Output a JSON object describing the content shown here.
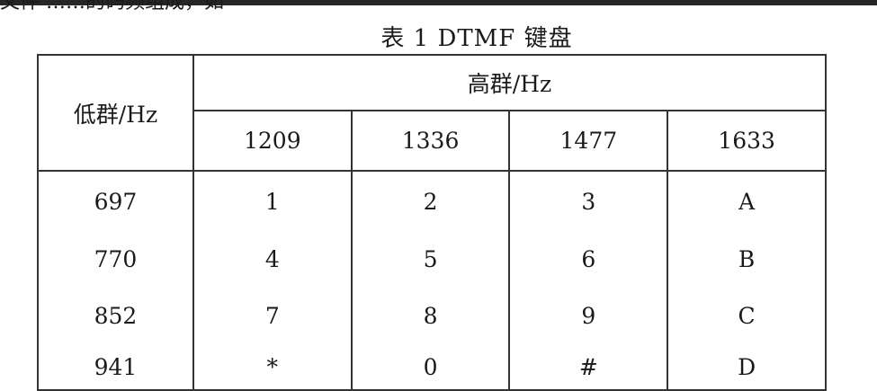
{
  "cut_text": "文件 ……的码频组成，如",
  "table": {
    "title": "表 1 DTMF 键盘",
    "low_group_label": "低群/Hz",
    "high_group_label": "高群/Hz",
    "high_freqs": [
      "1209",
      "1336",
      "1477",
      "1633"
    ],
    "rows": [
      {
        "low": "697",
        "keys": [
          "1",
          "2",
          "3",
          "A"
        ]
      },
      {
        "low": "770",
        "keys": [
          "4",
          "5",
          "6",
          "B"
        ]
      },
      {
        "low": "852",
        "keys": [
          "7",
          "8",
          "9",
          "C"
        ]
      },
      {
        "low": "941",
        "keys": [
          "*",
          "0",
          "#",
          "D"
        ]
      }
    ]
  }
}
